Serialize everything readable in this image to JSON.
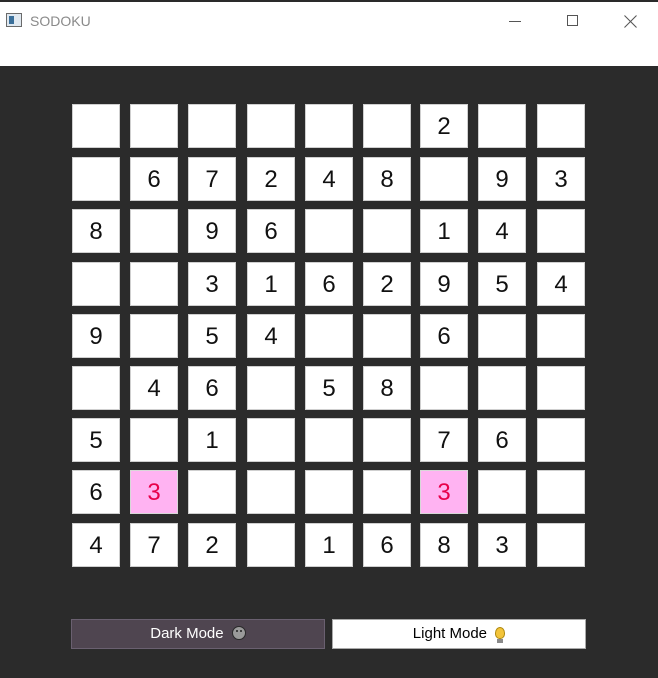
{
  "window": {
    "title": "SODOKU"
  },
  "board": {
    "rows": [
      [
        "",
        "",
        "",
        "",
        "",
        "",
        "2",
        "",
        ""
      ],
      [
        "",
        "6",
        "7",
        "2",
        "4",
        "8",
        "",
        "9",
        "3"
      ],
      [
        "8",
        "",
        "9",
        "6",
        "",
        "",
        "1",
        "4",
        ""
      ],
      [
        "",
        "",
        "3",
        "1",
        "6",
        "2",
        "9",
        "5",
        "4"
      ],
      [
        "9",
        "",
        "5",
        "4",
        "",
        "",
        "6",
        "",
        ""
      ],
      [
        "",
        "4",
        "6",
        "",
        "5",
        "8",
        "",
        "",
        ""
      ],
      [
        "5",
        "",
        "1",
        "",
        "",
        "",
        "7",
        "6",
        ""
      ],
      [
        "6",
        "3",
        "",
        "",
        "",
        "",
        "3",
        "",
        ""
      ],
      [
        "4",
        "7",
        "2",
        "",
        "1",
        "6",
        "8",
        "3",
        ""
      ]
    ],
    "conflicts": [
      [
        7,
        1
      ],
      [
        7,
        6
      ]
    ],
    "colors": {
      "conflict_bg": "#ffb3f2",
      "conflict_text": "#e8004a",
      "cell_bg": "#ffffff",
      "board_bg": "#2b2b2b"
    }
  },
  "buttons": {
    "dark_mode_label": "Dark Mode",
    "dark_mode_icon": "face-icon",
    "light_mode_label": "Light Mode",
    "light_mode_icon": "lightbulb-icon"
  }
}
